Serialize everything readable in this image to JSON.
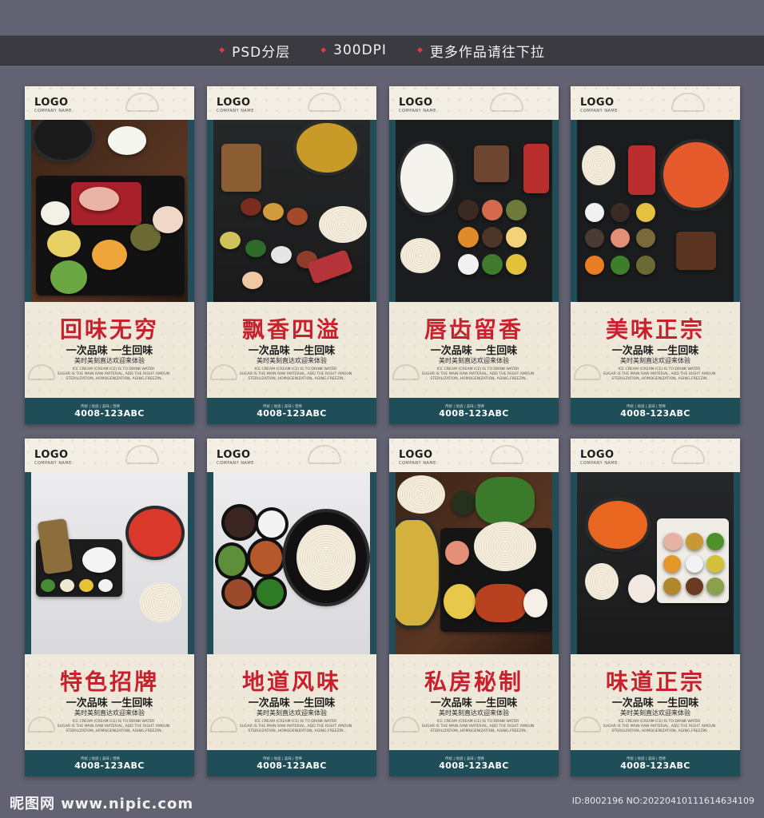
{
  "topbar": {
    "tags": [
      "PSD分层",
      "300DPI",
      "更多作品请往下拉"
    ],
    "dot_color": "#e23b3b"
  },
  "posters": [
    {
      "title": "回味无穷",
      "photo": "hotpot-tray-wood"
    },
    {
      "title": "飘香四溢",
      "photo": "hotpot-sauces-dark"
    },
    {
      "title": "唇齿留香",
      "photo": "broth-dishes-black"
    },
    {
      "title": "美味正宗",
      "photo": "tomato-pot-black"
    },
    {
      "title": "特色招牌",
      "photo": "hotpot-white-bg"
    },
    {
      "title": "地道风味",
      "photo": "noodle-bowls-white-bg"
    },
    {
      "title": "私房秘制",
      "photo": "duck-mushroom-spread"
    },
    {
      "title": "味道正宗",
      "photo": "spicy-pot-dark-wood"
    }
  ],
  "common": {
    "logo": "LOGO",
    "company": "COMPANY NAME",
    "slogan": "一次品味 一生回味",
    "subslogan": "美时美刻直达欢迎来体验",
    "english": [
      "ICE CREAM (CREAM ICE) IS TO DRINK WATER",
      "SUGAR IS THE MAIN RAW MATERIAL, ADD THE RIGHT AMOUN",
      "STERILIZATION, HOMOGENIZATION, AGING,FREEZIN"
    ],
    "footer_tiny": "传统 | 地道 | 美味 | 营养",
    "phone": "4008-123ABC",
    "title_color": "#c8202c",
    "footer_color": "#1f4e58"
  },
  "watermark": {
    "logo": "昵图网 www.nipic.com",
    "id": "ID:8002196 NO:20220410111614634109"
  }
}
